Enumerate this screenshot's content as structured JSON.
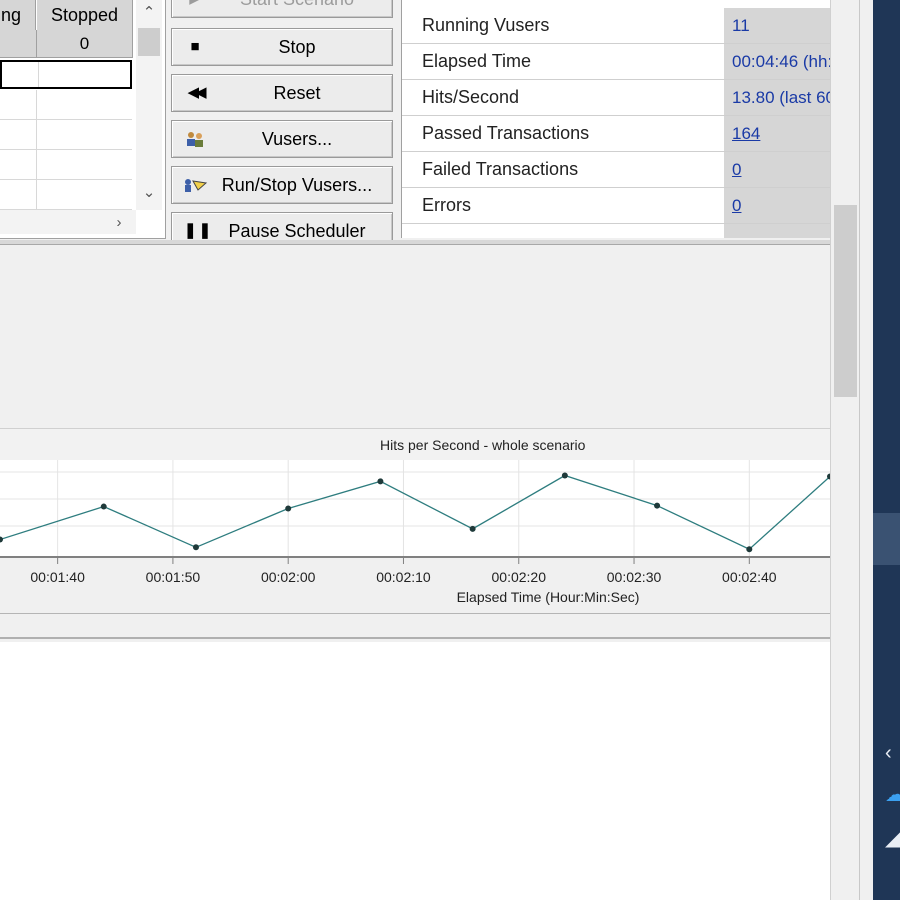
{
  "vuser_grid": {
    "headers": [
      "ng",
      "Stopped"
    ],
    "counts": [
      "",
      "0"
    ]
  },
  "controls": {
    "start_scenario": "Start Scenario",
    "stop": "Stop",
    "reset": "Reset",
    "vusers": "Vusers...",
    "run_stop_vusers": "Run/Stop Vusers...",
    "pause_scheduler": "Pause Scheduler"
  },
  "stats": [
    {
      "label": "Running Vusers",
      "value": "11"
    },
    {
      "label": "Elapsed Time",
      "value": "00:04:46 (hh:"
    },
    {
      "label": "Hits/Second",
      "value": "13.80 (last 60"
    },
    {
      "label": "Passed Transactions",
      "value": "164"
    },
    {
      "label": "Failed Transactions",
      "value": "0"
    },
    {
      "label": "Errors",
      "value": "0"
    }
  ],
  "chart_data": {
    "type": "line",
    "title": "Hits per Second - whole scenario",
    "xlabel": "Elapsed Time (Hour:Min:Sec)",
    "ylabel": "",
    "x_ticks": [
      "00:01:40",
      "00:01:50",
      "00:02:00",
      "00:02:10",
      "00:02:20",
      "00:02:30",
      "00:02:40"
    ],
    "x_range_seconds": [
      95,
      167
    ],
    "y_range": [
      0,
      100
    ],
    "grid": true,
    "series": [
      {
        "x": [
          "00:01:35",
          "00:01:44",
          "00:01:52",
          "00:02:00",
          "00:02:08",
          "00:02:16",
          "00:02:24",
          "00:02:32",
          "00:02:40",
          "00:02:47"
        ],
        "y": [
          18,
          52,
          10,
          50,
          78,
          29,
          84,
          53,
          8,
          83
        ]
      }
    ],
    "colors": {
      "line": "#2e7d7f",
      "marker": "#1f3a3a",
      "grid": "#e4e4e4"
    }
  }
}
